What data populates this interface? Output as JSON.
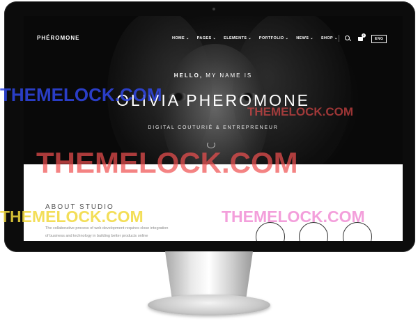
{
  "site": {
    "logo": "PHÉROMONE",
    "nav": [
      {
        "label": "HOME"
      },
      {
        "label": "PAGES"
      },
      {
        "label": "ELEMENTS"
      },
      {
        "label": "PORTFOLIO"
      },
      {
        "label": "NEWS"
      },
      {
        "label": "SHOP"
      }
    ],
    "cart_count": "0",
    "language": "ENG"
  },
  "hero": {
    "hello_bold": "HELLO,",
    "hello_rest": " MY NAME IS",
    "name": "OLIVIA PHEROMONE",
    "tagline": "DIGITAL COUTURIÉ & ENTREPRENEUR"
  },
  "about": {
    "title": "ABOUT STUDIO",
    "lines": [
      "The collaborative process of web development requires close integration",
      "of business and technology in building better products online"
    ]
  },
  "watermarks": [
    "THEMELOCK.COM",
    "THEMELOCK.COM",
    "THEMELOCK.COM",
    "THEMELOCK.COM",
    "THEMELOCK.COM"
  ]
}
